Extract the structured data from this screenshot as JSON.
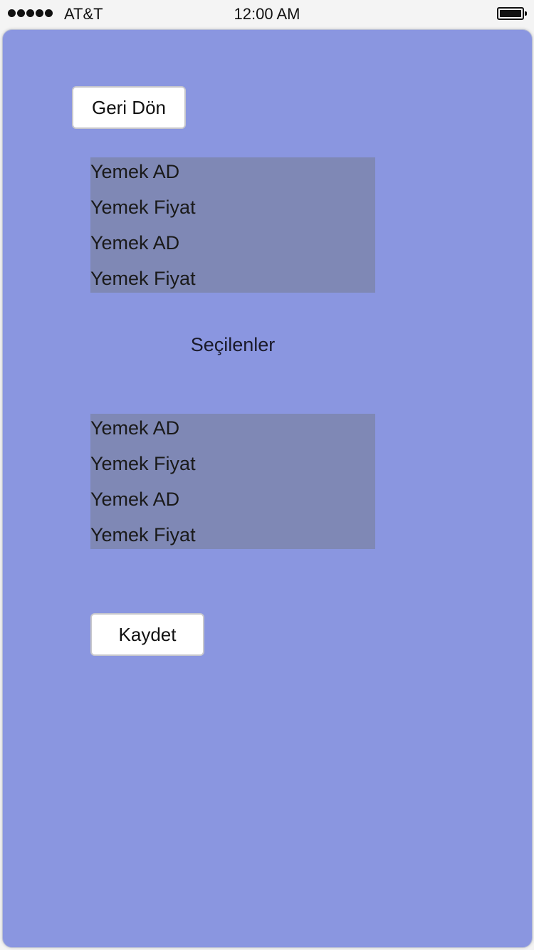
{
  "status_bar": {
    "carrier": "AT&T",
    "time": "12:00 AM",
    "signal_bars": 5,
    "battery_icon": "battery-full-icon"
  },
  "screen": {
    "background_color": "#8a96e0",
    "back_button_label": "Geri Dön",
    "menu_list": [
      {
        "label": "Yemek AD"
      },
      {
        "label": "Yemek Fiyat"
      },
      {
        "label": "Yemek AD"
      },
      {
        "label": "Yemek Fiyat"
      }
    ],
    "selected_title": "Seçilenler",
    "selected_list": [
      {
        "label": "Yemek AD"
      },
      {
        "label": "Yemek Fiyat"
      },
      {
        "label": "Yemek AD"
      },
      {
        "label": "Yemek Fiyat"
      }
    ],
    "save_button_label": "Kaydet"
  }
}
